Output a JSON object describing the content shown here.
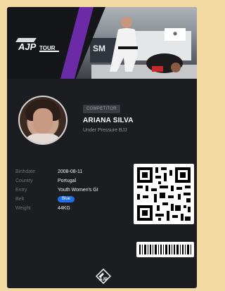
{
  "header": {
    "brand_logo": "ajp-tour-logo",
    "photo_alt": "bjj-match-photo",
    "wall_text": "SM"
  },
  "profile": {
    "role": "COMPETITOR",
    "name": "ARIANA SILVA",
    "team": "Under Pressure BJJ"
  },
  "details": {
    "birthdate_label": "Birthdate",
    "birthdate_value": "2008-08-11",
    "country_label": "Country",
    "country_value": "Portugal",
    "entry_label": "Entry",
    "entry_value": "Youth Women's GI",
    "belt_label": "Belt",
    "belt_value": "Blue",
    "weight_label": "Weight",
    "weight_value": "44KG"
  },
  "colors": {
    "card_bg": "#1c1d21",
    "accent_purple": "#6b2ba6",
    "belt_blue": "#1f6fe5",
    "page_bg": "#f3d9a2"
  },
  "icons": {
    "qr": "qr-code",
    "barcode": "barcode",
    "footer": "ajp-logo"
  }
}
